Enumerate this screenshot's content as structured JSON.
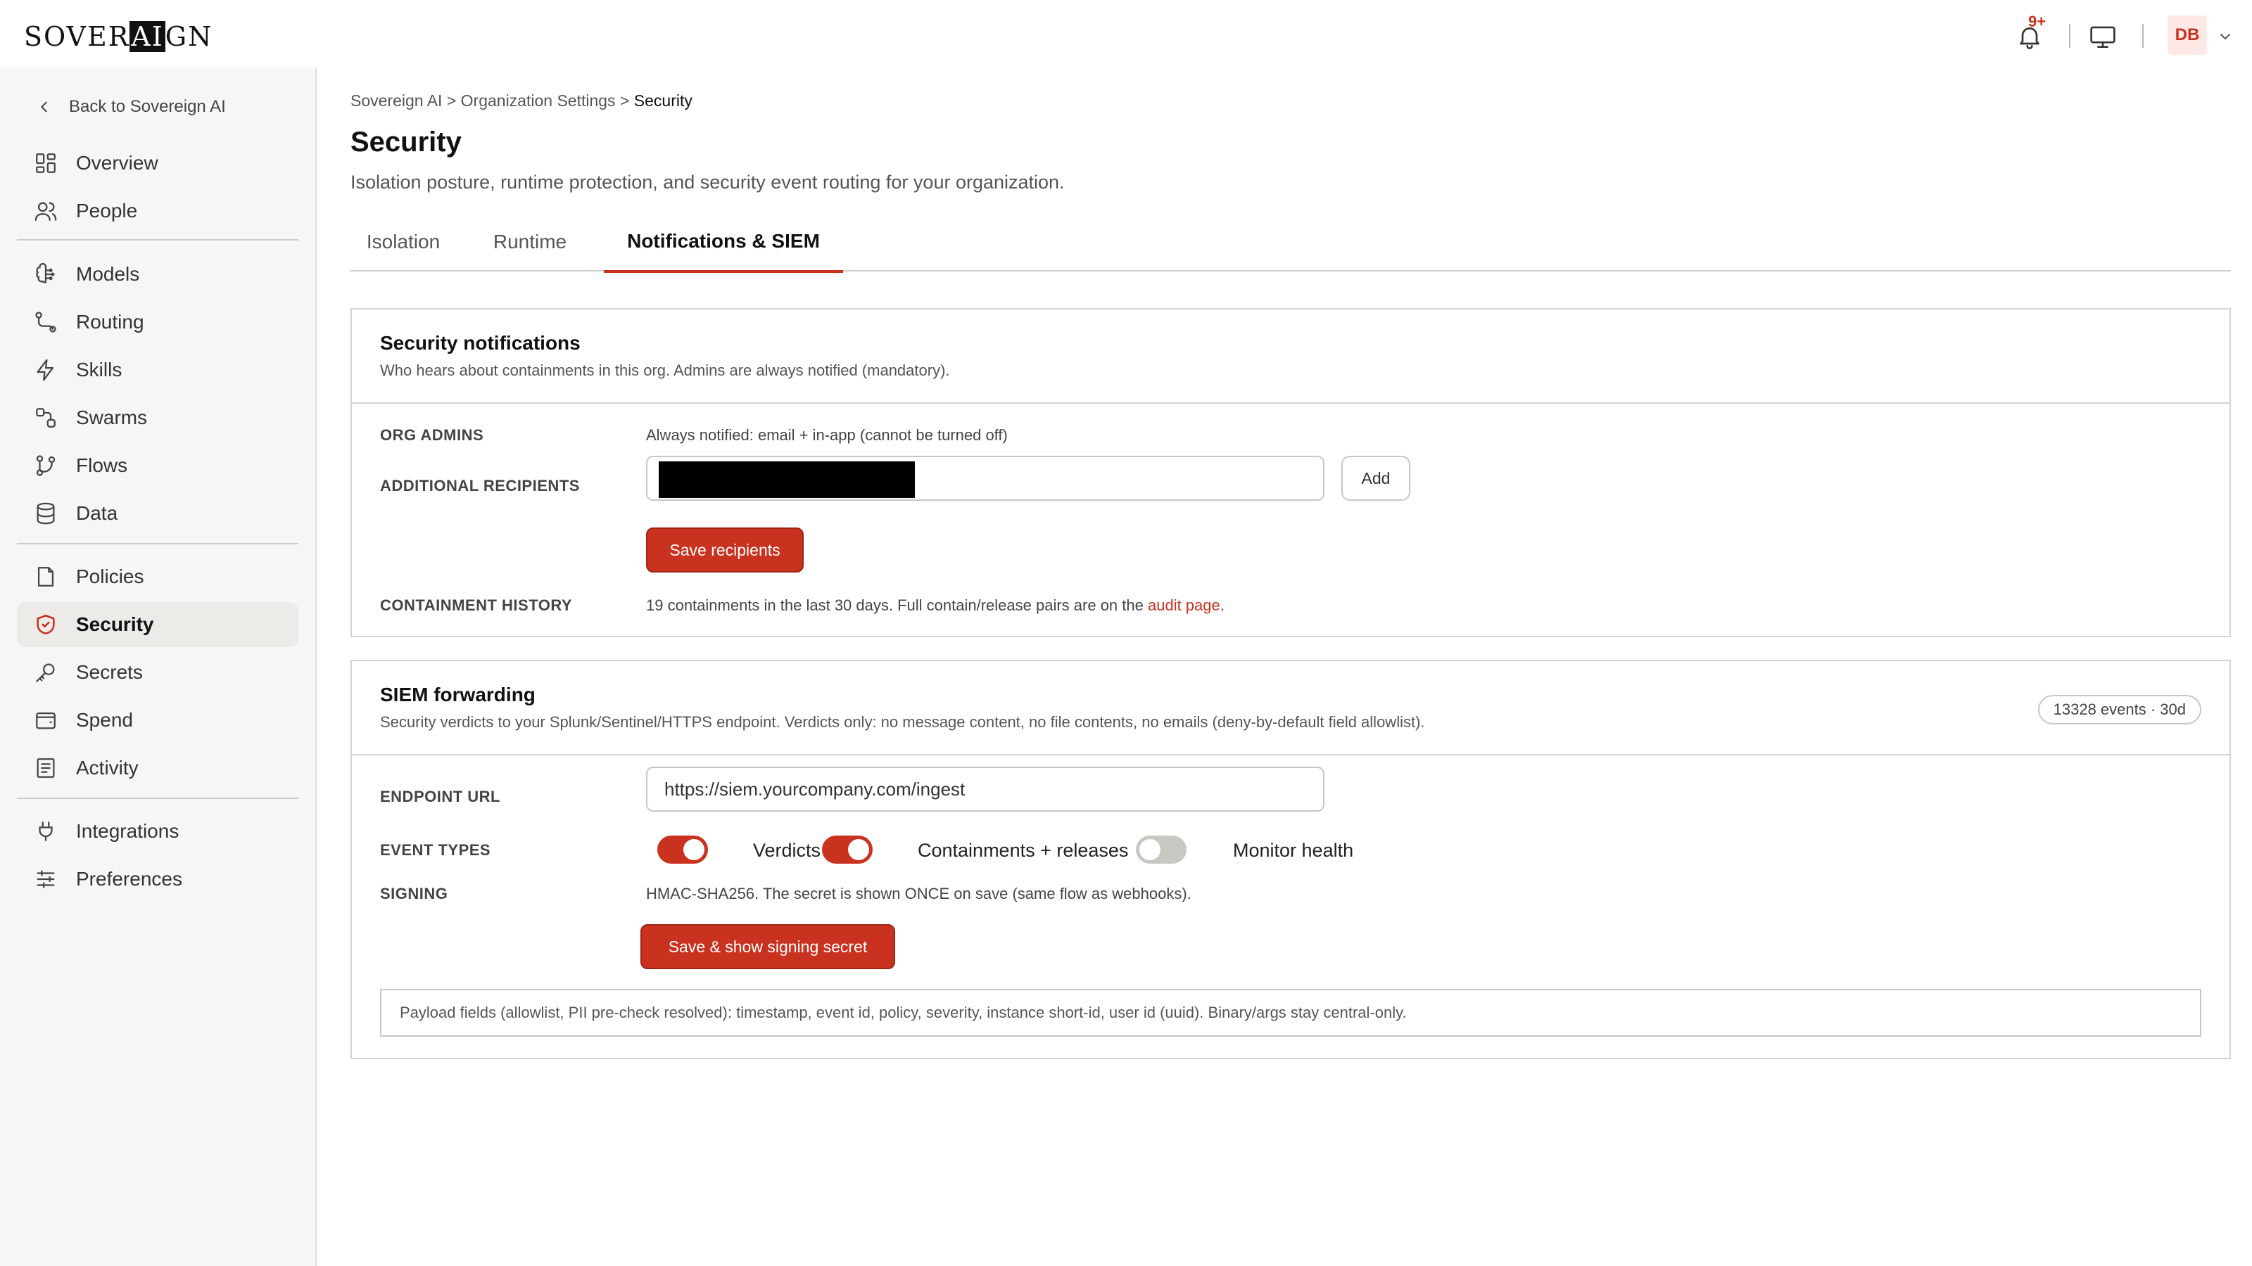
{
  "brand": {
    "logo_pre": "SOVER",
    "logo_hl": "AI",
    "logo_post": "GN"
  },
  "header": {
    "notification_badge": "9+",
    "avatar_initials": "DB"
  },
  "sidebar": {
    "back_label": "Back to Sovereign AI",
    "items": [
      {
        "label": "Overview",
        "icon": "grid-icon"
      },
      {
        "label": "People",
        "icon": "people-icon"
      },
      {
        "label": "Models",
        "icon": "brain-icon"
      },
      {
        "label": "Routing",
        "icon": "route-icon"
      },
      {
        "label": "Skills",
        "icon": "bolt-icon"
      },
      {
        "label": "Swarms",
        "icon": "swarm-icon"
      },
      {
        "label": "Flows",
        "icon": "branch-icon"
      },
      {
        "label": "Data",
        "icon": "database-icon"
      },
      {
        "label": "Policies",
        "icon": "document-icon"
      },
      {
        "label": "Security",
        "icon": "shield-icon",
        "active": true
      },
      {
        "label": "Secrets",
        "icon": "key-icon"
      },
      {
        "label": "Spend",
        "icon": "wallet-icon"
      },
      {
        "label": "Activity",
        "icon": "list-icon"
      },
      {
        "label": "Integrations",
        "icon": "plug-icon"
      },
      {
        "label": "Preferences",
        "icon": "sliders-icon"
      }
    ]
  },
  "breadcrumb": {
    "part1": "Sovereign AI",
    "sep": ">",
    "part2": "Organization Settings",
    "current": "Security"
  },
  "page": {
    "title": "Security",
    "subtitle": "Isolation posture, runtime protection, and security event routing for your organization."
  },
  "tabs": [
    {
      "label": "Isolation"
    },
    {
      "label": "Runtime"
    },
    {
      "label": "Notifications & SIEM",
      "active": true
    }
  ],
  "notifications": {
    "title": "Security notifications",
    "subtitle": "Who hears about containments in this org. Admins are always notified (mandatory).",
    "org_admins_label": "ORG ADMINS",
    "org_admins_value": "Always notified: email + in-app (cannot be turned off)",
    "recipients_label": "ADDITIONAL RECIPIENTS",
    "add_label": "Add",
    "save_label": "Save recipients",
    "history_label": "CONTAINMENT HISTORY",
    "history_text": "19 containments in the last 30 days. Full contain/release pairs are on the",
    "history_link": "audit page",
    "history_end": "."
  },
  "siem": {
    "title": "SIEM forwarding",
    "subtitle": "Security verdicts to your Splunk/Sentinel/HTTPS endpoint. Verdicts only: no message content, no file contents, no emails (deny-by-default field allowlist).",
    "events_pill": "13328 events · 30d",
    "endpoint_label": "ENDPOINT URL",
    "endpoint_value": "https://siem.yourcompany.com/ingest",
    "event_types_label": "EVENT TYPES",
    "toggles": [
      {
        "label": "Verdicts",
        "on": true
      },
      {
        "label": "Containments + releases",
        "on": true
      },
      {
        "label": "Monitor health",
        "on": false
      }
    ],
    "signing_label": "SIGNING",
    "signing_text": "HMAC-SHA256. The secret is shown ONCE on save (same flow as webhooks).",
    "save_label": "Save & show signing secret",
    "payload_text": "Payload fields (allowlist, PII pre-check resolved): timestamp, event id, policy, severity, instance short-id, user id (uuid). Binary/args stay central-only."
  },
  "colors": {
    "accent": "#c9321f",
    "sidebar_bg": "#f7f6f4",
    "border": "#d5d3ce"
  }
}
